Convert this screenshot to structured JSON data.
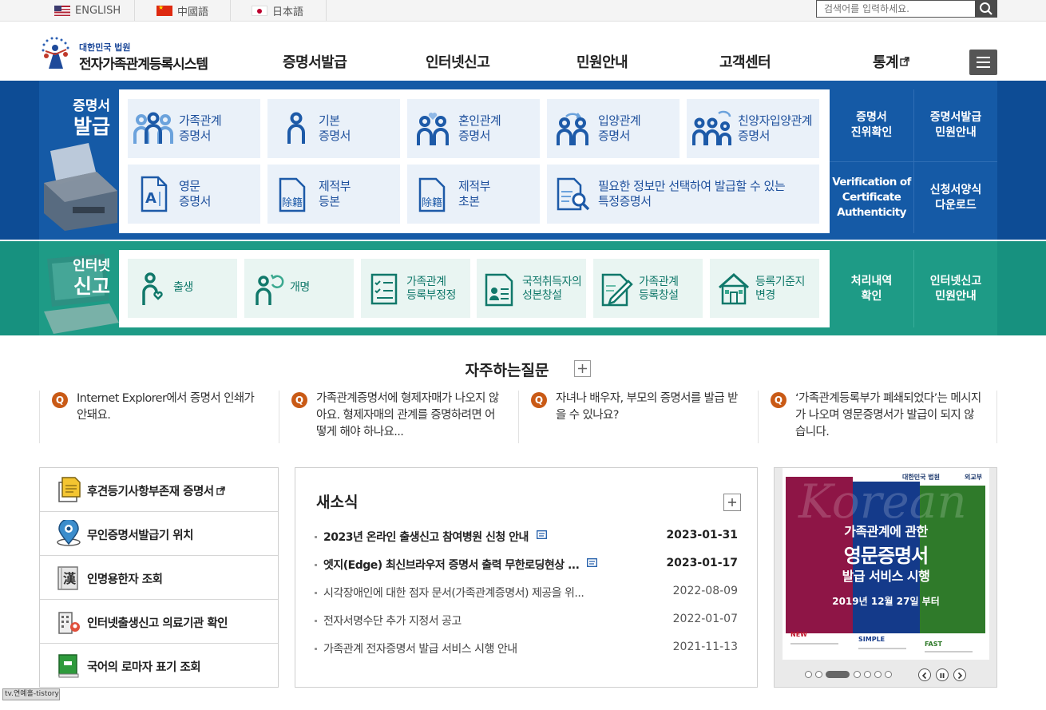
{
  "top_languages": [
    {
      "label": "ENGLISH"
    },
    {
      "label": "中國語"
    },
    {
      "label": "日本語"
    }
  ],
  "search": {
    "placeholder": "검색어를 입력하세요."
  },
  "logo": {
    "sub": "대한민국 법원",
    "main": "전자가족관계등록시스템"
  },
  "gnb": [
    "증명서발급",
    "인터넷신고",
    "민원안내",
    "고객센터",
    "통계"
  ],
  "issue": {
    "title_line1": "증명서",
    "title_line2": "발급",
    "tiles": [
      "가족관계\n증명서",
      "기본\n증명서",
      "혼인관계\n증명서",
      "입양관계\n증명서",
      "친양자입양관계\n증명서",
      "영문\n증명서",
      "제적부\n등본",
      "제적부\n초본",
      "필요한 정보만 선택하여 발급할 수 있는\n특정증명서"
    ],
    "side": [
      "증명서\n진위확인",
      "증명서발급\n민원안내",
      "Verification of\nCertificate\nAuthenticity",
      "신청서양식\n다운로드"
    ]
  },
  "report": {
    "title_line1": "인터넷",
    "title_line2": "신고",
    "tiles": [
      "출생",
      "개명",
      "가족관계\n등록부정정",
      "국적취득자의\n성본창설",
      "가족관계\n등록창설",
      "등록기준지\n변경"
    ],
    "side": [
      "처리내역\n확인",
      "인터넷신고\n민원안내"
    ]
  },
  "faq": {
    "title": "자주하는질문",
    "q_mark": "Q",
    "items": [
      "Internet Explorer에서 증명서 인쇄가 안돼요.",
      "가족관계증명서에 형제자매가 나오지 않아요. 형제자매의 관계를 증명하려면 어떻게 해야 하나요...",
      "자녀나 배우자, 부모의 증명서를 발급 받을 수 있나요?",
      "‘가족관계등록부가 폐쇄되었다’는 메시지가 나오며 영문증명서가 발급이 되지 않습니다."
    ]
  },
  "quick_links": [
    {
      "label": "후견등기사항부존재 증명서",
      "icon": "document-icon"
    },
    {
      "label": "무인증명서발급기 위치",
      "icon": "map-pin-icon"
    },
    {
      "label": "인명용한자 조회",
      "icon": "hanja-book-icon"
    },
    {
      "label": "인터넷출생신고 의료기관 확인",
      "icon": "hospital-icon"
    },
    {
      "label": "국어의 로마자 표기 조회",
      "icon": "green-book-icon"
    }
  ],
  "news": {
    "title": "새소식",
    "items": [
      {
        "title": "2023년 온라인 출생신고 참여병원 신청 안내",
        "date": "2023-01-31",
        "new": true
      },
      {
        "title": "엣지(Edge) 최신브라우저 증명서 출력 무한로딩현상 ...",
        "date": "2023-01-17",
        "new": true
      },
      {
        "title": "시각장애인에 대한 점자 문서(가족관계증명서) 제공을 위...",
        "date": "2022-08-09",
        "new": false
      },
      {
        "title": "전자서명수단 추가 지정서 공고",
        "date": "2022-01-07",
        "new": false
      },
      {
        "title": "가족관계 전자증명서 발급 서비스 시행 안내",
        "date": "2021-11-13",
        "new": false
      }
    ]
  },
  "banner": {
    "org1": "대한민국 법원",
    "org2": "외교부",
    "bg_word": "Korean",
    "line1": "가족관계에 관한",
    "line2": "영문증명서",
    "line3": "발급 서비스 시행",
    "date": "2019년 12월 27일 부터",
    "tags": [
      "NEW",
      "SIMPLE",
      "FAST"
    ],
    "colors": {
      "left": "#8e1546",
      "mid": "#143a8a",
      "right": "#2f7a2a"
    }
  },
  "tooltip": "tv.연예홀-tistory",
  "colors": {
    "blue": "#155aa6",
    "teal": "#1e9b86",
    "accent_q": "#c95a16"
  }
}
